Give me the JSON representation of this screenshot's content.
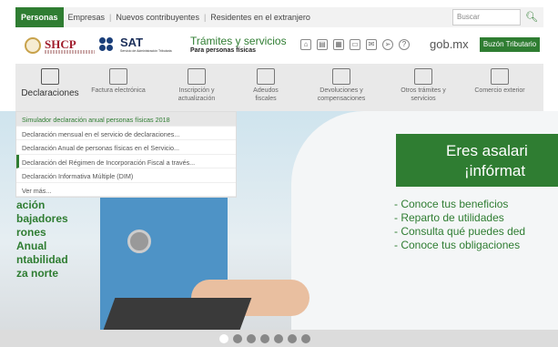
{
  "topbar": {
    "tabs": [
      "Personas",
      "Empresas",
      "Nuevos contribuyentes",
      "Residentes en el extranjero"
    ],
    "search_placeholder": "Buscar",
    "search_icon": "search-icon"
  },
  "brand": {
    "shcp": "SHCP",
    "sat": "SAT",
    "sat_sub": "Servicio de Administración Tributaria",
    "tramites_title": "Trámites y servicios",
    "tramites_sub": "Para personas físicas",
    "gobmx": "gob.mx",
    "buzon_label": "Buzón Tributario",
    "icons": [
      "home-icon",
      "document-icon",
      "calendar-icon",
      "book-icon",
      "mail-icon",
      "compass-icon",
      "help-icon"
    ]
  },
  "nav": {
    "items": [
      {
        "label": "Declaraciones",
        "icon": "declaraciones-icon"
      },
      {
        "label": "Factura electrónica",
        "icon": "factura-icon"
      },
      {
        "label": "Inscripción y actualización",
        "icon": "inscripcion-icon"
      },
      {
        "label": "Adeudos fiscales",
        "icon": "adeudos-icon"
      },
      {
        "label": "Devoluciones y compensaciones",
        "icon": "devoluciones-icon"
      },
      {
        "label": "Otros trámites y servicios",
        "icon": "otros-tramites-icon"
      },
      {
        "label": "Comercio exterior",
        "icon": "comercio-exterior-icon"
      }
    ]
  },
  "dropdown": {
    "items": [
      "Simulador declaración anual personas físicas 2018",
      "Declaración mensual en el servicio de declaraciones...",
      "Declaración Anual de personas físicas en el Servicio...",
      "Declaración del Régimen de Incorporación Fiscal a través...",
      "Declaración Informativa Múltiple (DIM)",
      "Ver más..."
    ]
  },
  "hero": {
    "left_lines": [
      "ación",
      "bajadores",
      "rones",
      "Anual",
      "ntabilidad",
      "za norte"
    ],
    "banner_line1": "Eres asalari",
    "banner_line2": "¡infórmat",
    "bullets": [
      "- Conoce tus beneficios",
      "- Reparto de utilidades",
      "- Consulta qué puedes ded",
      "- Conoce tus obligaciones"
    ]
  },
  "carousel": {
    "count": 7,
    "active_index": 0
  },
  "colors": {
    "accent": "#2f7d32",
    "shcp": "#a01c2c",
    "sat": "#1b3f7a"
  }
}
